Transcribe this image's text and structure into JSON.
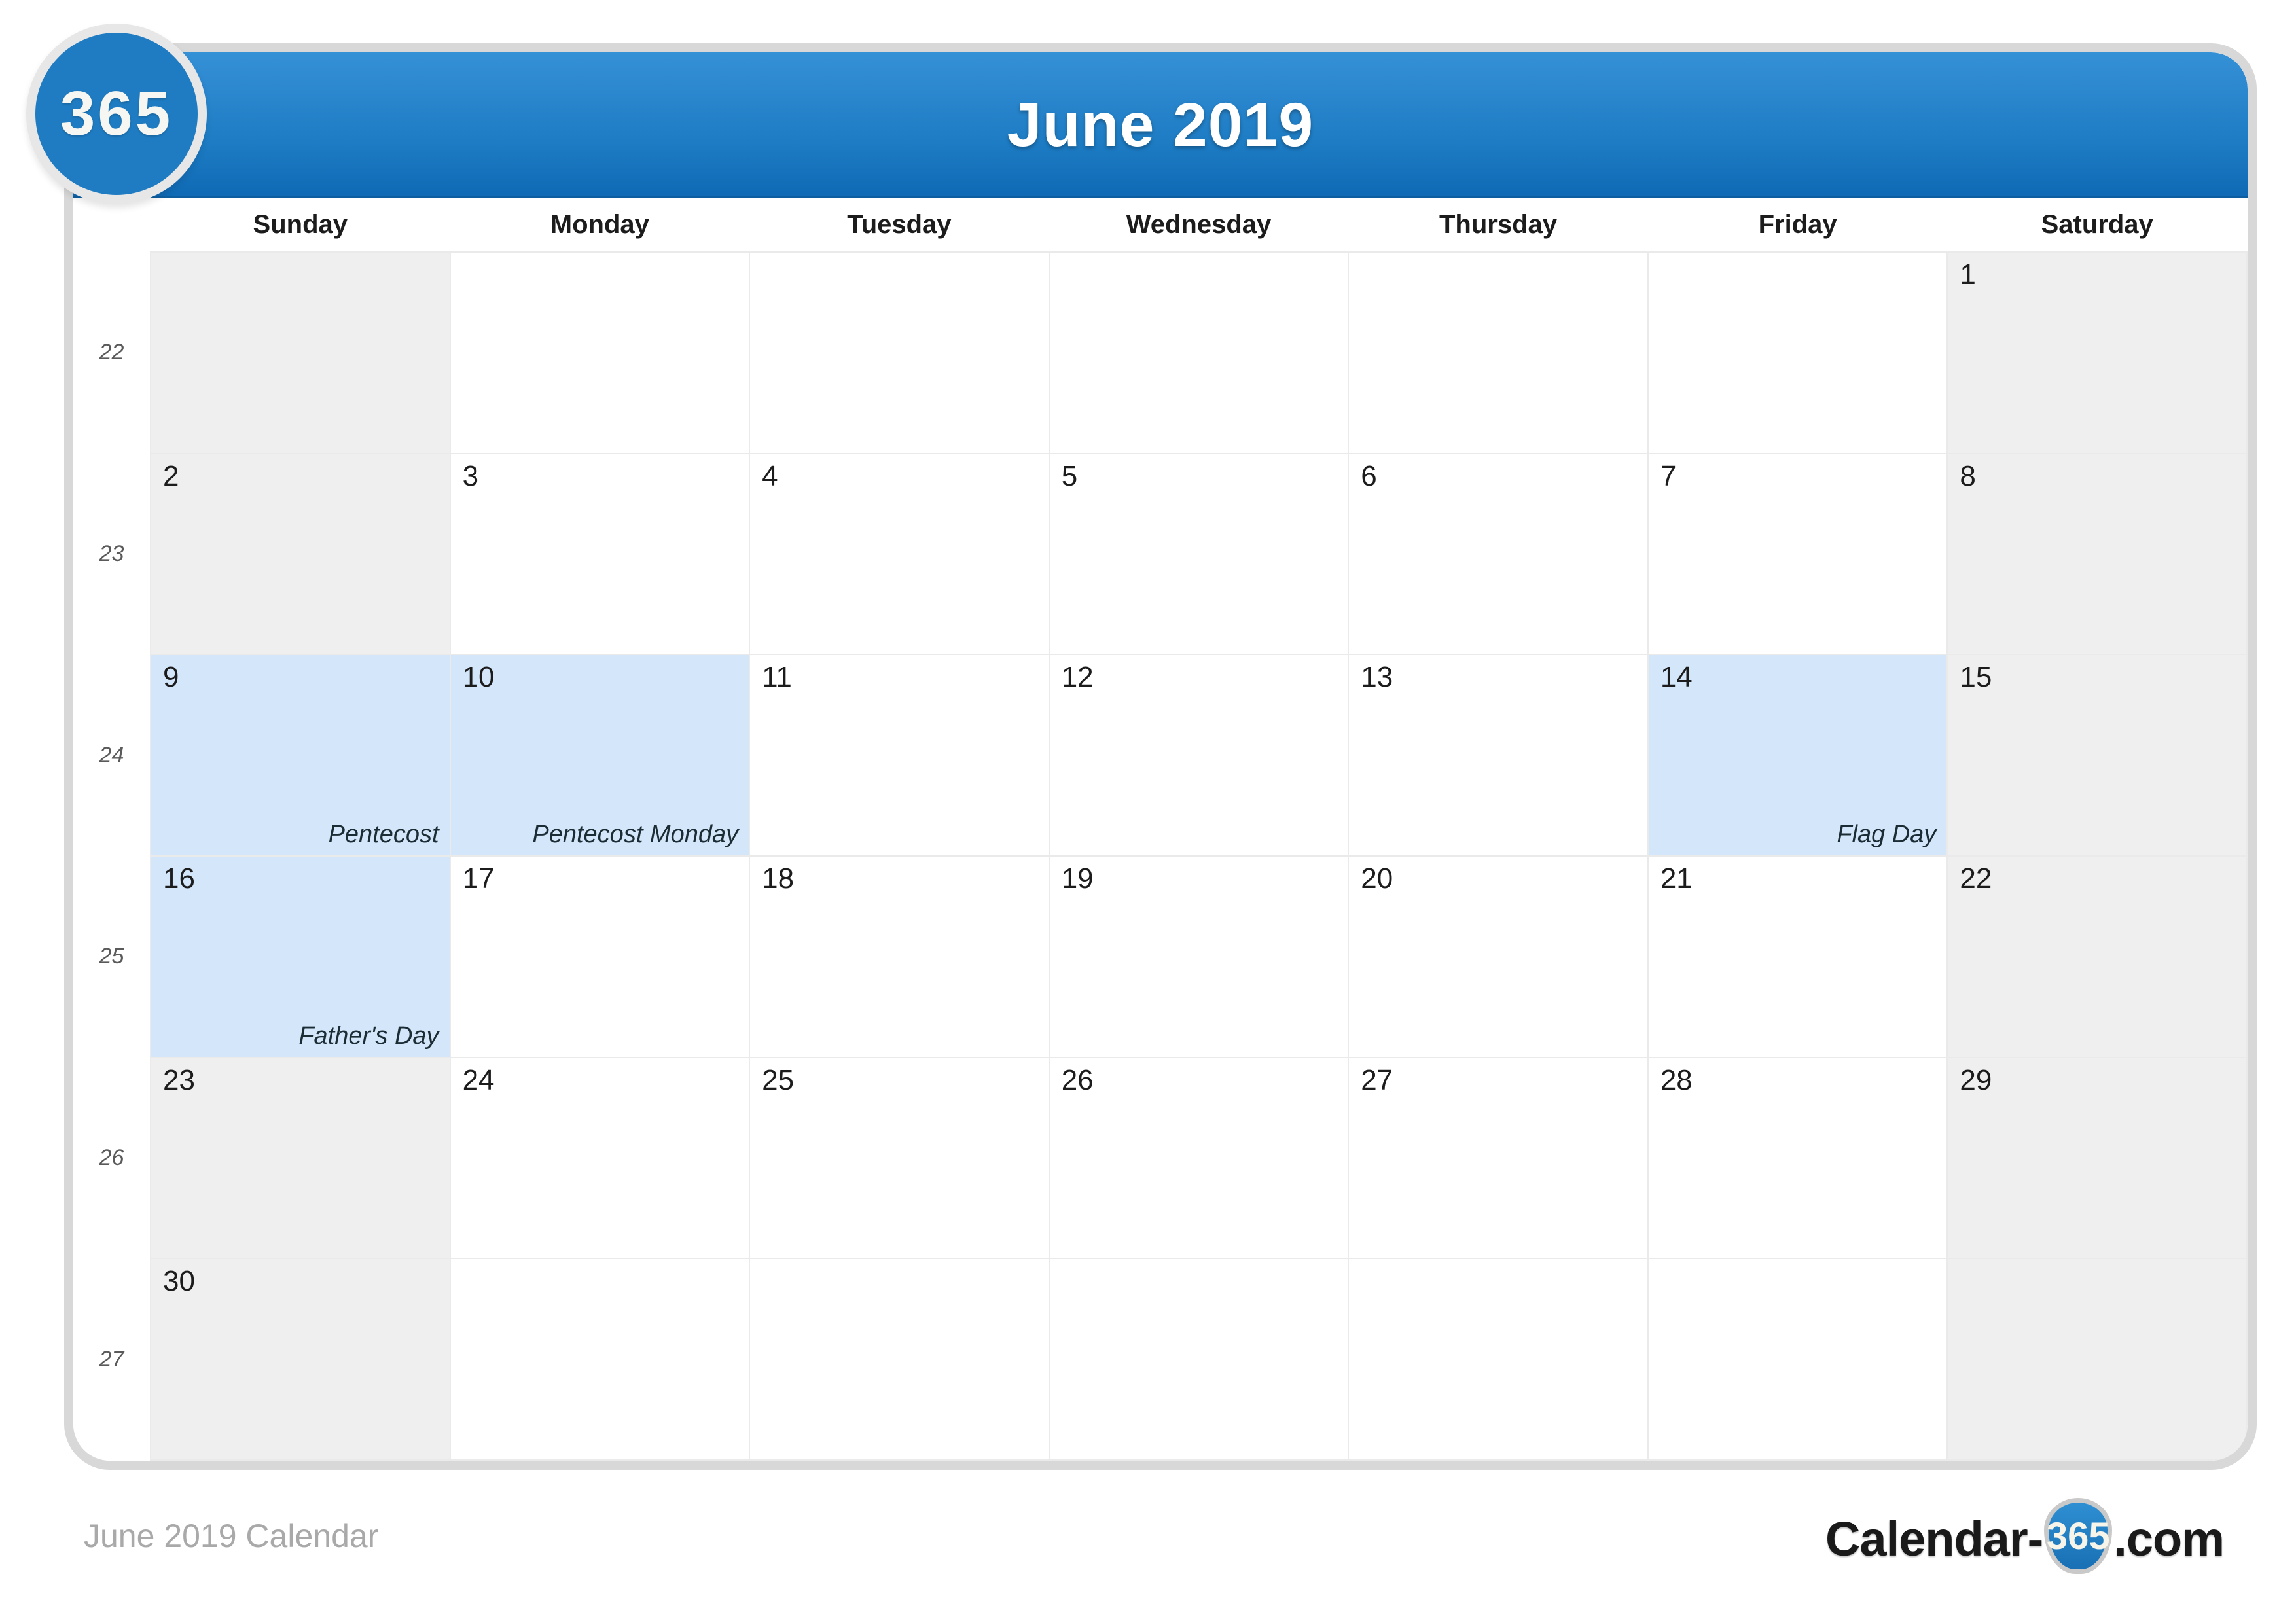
{
  "badge": {
    "label": "365"
  },
  "header": {
    "title": "June 2019"
  },
  "weekdays": [
    "Sunday",
    "Monday",
    "Tuesday",
    "Wednesday",
    "Thursday",
    "Friday",
    "Saturday"
  ],
  "watermark": {
    "text": "365"
  },
  "colors": {
    "header_blue_top": "#3591d6",
    "header_blue_bottom": "#0f69b4",
    "badge_blue": "#1f7cc2",
    "weekend_gray": "#efefef",
    "holiday_blue": "#d3e6fa",
    "grid_line": "#eaeaea",
    "card_border": "#d8d8d8",
    "footer_text": "#a9a9a9"
  },
  "weeks": [
    {
      "week_number": "22",
      "days": [
        {
          "num": "",
          "holiday": "",
          "weekend": true,
          "highlight": false
        },
        {
          "num": "",
          "holiday": "",
          "weekend": false,
          "highlight": false
        },
        {
          "num": "",
          "holiday": "",
          "weekend": false,
          "highlight": false
        },
        {
          "num": "",
          "holiday": "",
          "weekend": false,
          "highlight": false
        },
        {
          "num": "",
          "holiday": "",
          "weekend": false,
          "highlight": false
        },
        {
          "num": "",
          "holiday": "",
          "weekend": false,
          "highlight": false
        },
        {
          "num": "1",
          "holiday": "",
          "weekend": true,
          "highlight": false
        }
      ]
    },
    {
      "week_number": "23",
      "days": [
        {
          "num": "2",
          "holiday": "",
          "weekend": true,
          "highlight": false
        },
        {
          "num": "3",
          "holiday": "",
          "weekend": false,
          "highlight": false
        },
        {
          "num": "4",
          "holiday": "",
          "weekend": false,
          "highlight": false
        },
        {
          "num": "5",
          "holiday": "",
          "weekend": false,
          "highlight": false
        },
        {
          "num": "6",
          "holiday": "",
          "weekend": false,
          "highlight": false
        },
        {
          "num": "7",
          "holiday": "",
          "weekend": false,
          "highlight": false
        },
        {
          "num": "8",
          "holiday": "",
          "weekend": true,
          "highlight": false
        }
      ]
    },
    {
      "week_number": "24",
      "days": [
        {
          "num": "9",
          "holiday": "Pentecost",
          "weekend": true,
          "highlight": true
        },
        {
          "num": "10",
          "holiday": "Pentecost Monday",
          "weekend": false,
          "highlight": true
        },
        {
          "num": "11",
          "holiday": "",
          "weekend": false,
          "highlight": false
        },
        {
          "num": "12",
          "holiday": "",
          "weekend": false,
          "highlight": false
        },
        {
          "num": "13",
          "holiday": "",
          "weekend": false,
          "highlight": false
        },
        {
          "num": "14",
          "holiday": "Flag Day",
          "weekend": false,
          "highlight": true
        },
        {
          "num": "15",
          "holiday": "",
          "weekend": true,
          "highlight": false
        }
      ]
    },
    {
      "week_number": "25",
      "days": [
        {
          "num": "16",
          "holiday": "Father's Day",
          "weekend": true,
          "highlight": true
        },
        {
          "num": "17",
          "holiday": "",
          "weekend": false,
          "highlight": false
        },
        {
          "num": "18",
          "holiday": "",
          "weekend": false,
          "highlight": false
        },
        {
          "num": "19",
          "holiday": "",
          "weekend": false,
          "highlight": false
        },
        {
          "num": "20",
          "holiday": "",
          "weekend": false,
          "highlight": false
        },
        {
          "num": "21",
          "holiday": "",
          "weekend": false,
          "highlight": false
        },
        {
          "num": "22",
          "holiday": "",
          "weekend": true,
          "highlight": false
        }
      ]
    },
    {
      "week_number": "26",
      "days": [
        {
          "num": "23",
          "holiday": "",
          "weekend": true,
          "highlight": false
        },
        {
          "num": "24",
          "holiday": "",
          "weekend": false,
          "highlight": false
        },
        {
          "num": "25",
          "holiday": "",
          "weekend": false,
          "highlight": false
        },
        {
          "num": "26",
          "holiday": "",
          "weekend": false,
          "highlight": false
        },
        {
          "num": "27",
          "holiday": "",
          "weekend": false,
          "highlight": false
        },
        {
          "num": "28",
          "holiday": "",
          "weekend": false,
          "highlight": false
        },
        {
          "num": "29",
          "holiday": "",
          "weekend": true,
          "highlight": false
        }
      ]
    },
    {
      "week_number": "27",
      "days": [
        {
          "num": "30",
          "holiday": "",
          "weekend": true,
          "highlight": false
        },
        {
          "num": "",
          "holiday": "",
          "weekend": false,
          "highlight": false
        },
        {
          "num": "",
          "holiday": "",
          "weekend": false,
          "highlight": false
        },
        {
          "num": "",
          "holiday": "",
          "weekend": false,
          "highlight": false
        },
        {
          "num": "",
          "holiday": "",
          "weekend": false,
          "highlight": false
        },
        {
          "num": "",
          "holiday": "",
          "weekend": false,
          "highlight": false
        },
        {
          "num": "",
          "holiday": "",
          "weekend": true,
          "highlight": false
        }
      ]
    }
  ],
  "footer": {
    "left_text": "June 2019 Calendar",
    "logo_word": "Calendar-",
    "logo_badge": "365",
    "logo_tld": ".com"
  }
}
